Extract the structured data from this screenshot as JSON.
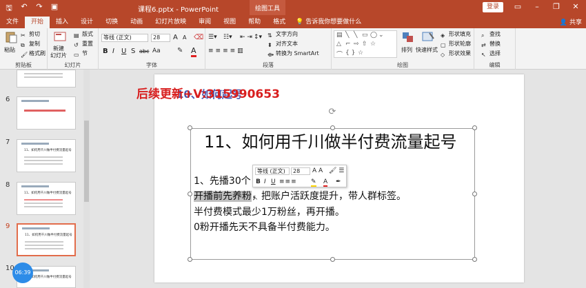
{
  "titlebar": {
    "doc_title": "课程6.pptx - PowerPoint",
    "context_tools": "绘图工具",
    "login": "登录",
    "qat": {
      "save": "🖫",
      "undo": "↶",
      "redo": "↷",
      "present": "▣"
    }
  },
  "tabs": {
    "items": [
      "文件",
      "开始",
      "插入",
      "设计",
      "切换",
      "动画",
      "幻灯片放映",
      "审阅",
      "视图",
      "帮助",
      "格式"
    ],
    "active": "开始",
    "tell_me": "告诉我你想要做什么",
    "share": "共享"
  },
  "ribbon": {
    "clipboard": {
      "label": "剪贴板",
      "paste": "粘贴",
      "cut": "剪切",
      "copy": "复制",
      "format_painter": "格式刷"
    },
    "slides": {
      "label": "幻灯片",
      "new_slide": "新建",
      "new_slide2": "幻灯片",
      "layout": "版式",
      "reset": "重置",
      "section": "节"
    },
    "font": {
      "label": "字体",
      "font_name": "等线 (正文)",
      "font_size": "28",
      "bold": "B",
      "italic": "I",
      "underline": "U",
      "strike": "S",
      "spacing": "abc",
      "case": "Aa",
      "grow": "A",
      "shrink": "A"
    },
    "paragraph": {
      "label": "段落",
      "text_direction": "文字方向",
      "align_text": "对齐文本",
      "smartart": "转换为 SmartArt"
    },
    "drawing": {
      "label": "绘图",
      "arrange": "排列",
      "quick_styles": "快速样式",
      "fill": "形状填充",
      "outline": "形状轮廓",
      "effects": "形状效果"
    },
    "editing": {
      "label": "编辑",
      "find": "查找",
      "replace": "替换",
      "select": "选择"
    }
  },
  "panel": {
    "thumbnails": [
      {
        "number": "",
        "title": ""
      },
      {
        "number": "6",
        "title": ""
      },
      {
        "number": "7",
        "title": "11、如何用千川做半付费流量起号"
      },
      {
        "number": "8",
        "title": "11、如何用千川做半付费流量起号"
      },
      {
        "number": "9",
        "title": "11、如何用千川做半付费流量起号"
      },
      {
        "number": "10",
        "title": "11、如何用千川做半付费流量起号"
      }
    ],
    "timer": "06:39"
  },
  "slide": {
    "watermark": "后续更新+V:315990653",
    "watermark2": "10、如何起号",
    "heading": "11、如何用千川做半付费流量起号",
    "line1": "1、先播30个",
    "line2_highlight": "开播前先养粉",
    "line2_rest": "，把账户活跃度提升，带人群标签。",
    "line3": "半付费模式最少1万粉丝，再开播。",
    "line4": "0粉开播先天不具备半付费能力。"
  },
  "mini_toolbar": {
    "font_name": "等线 (正文)",
    "font_size": "28"
  },
  "colors": {
    "accent": "#b7472a",
    "selection": "#e26c4a",
    "watermark": "#d81e1e"
  }
}
